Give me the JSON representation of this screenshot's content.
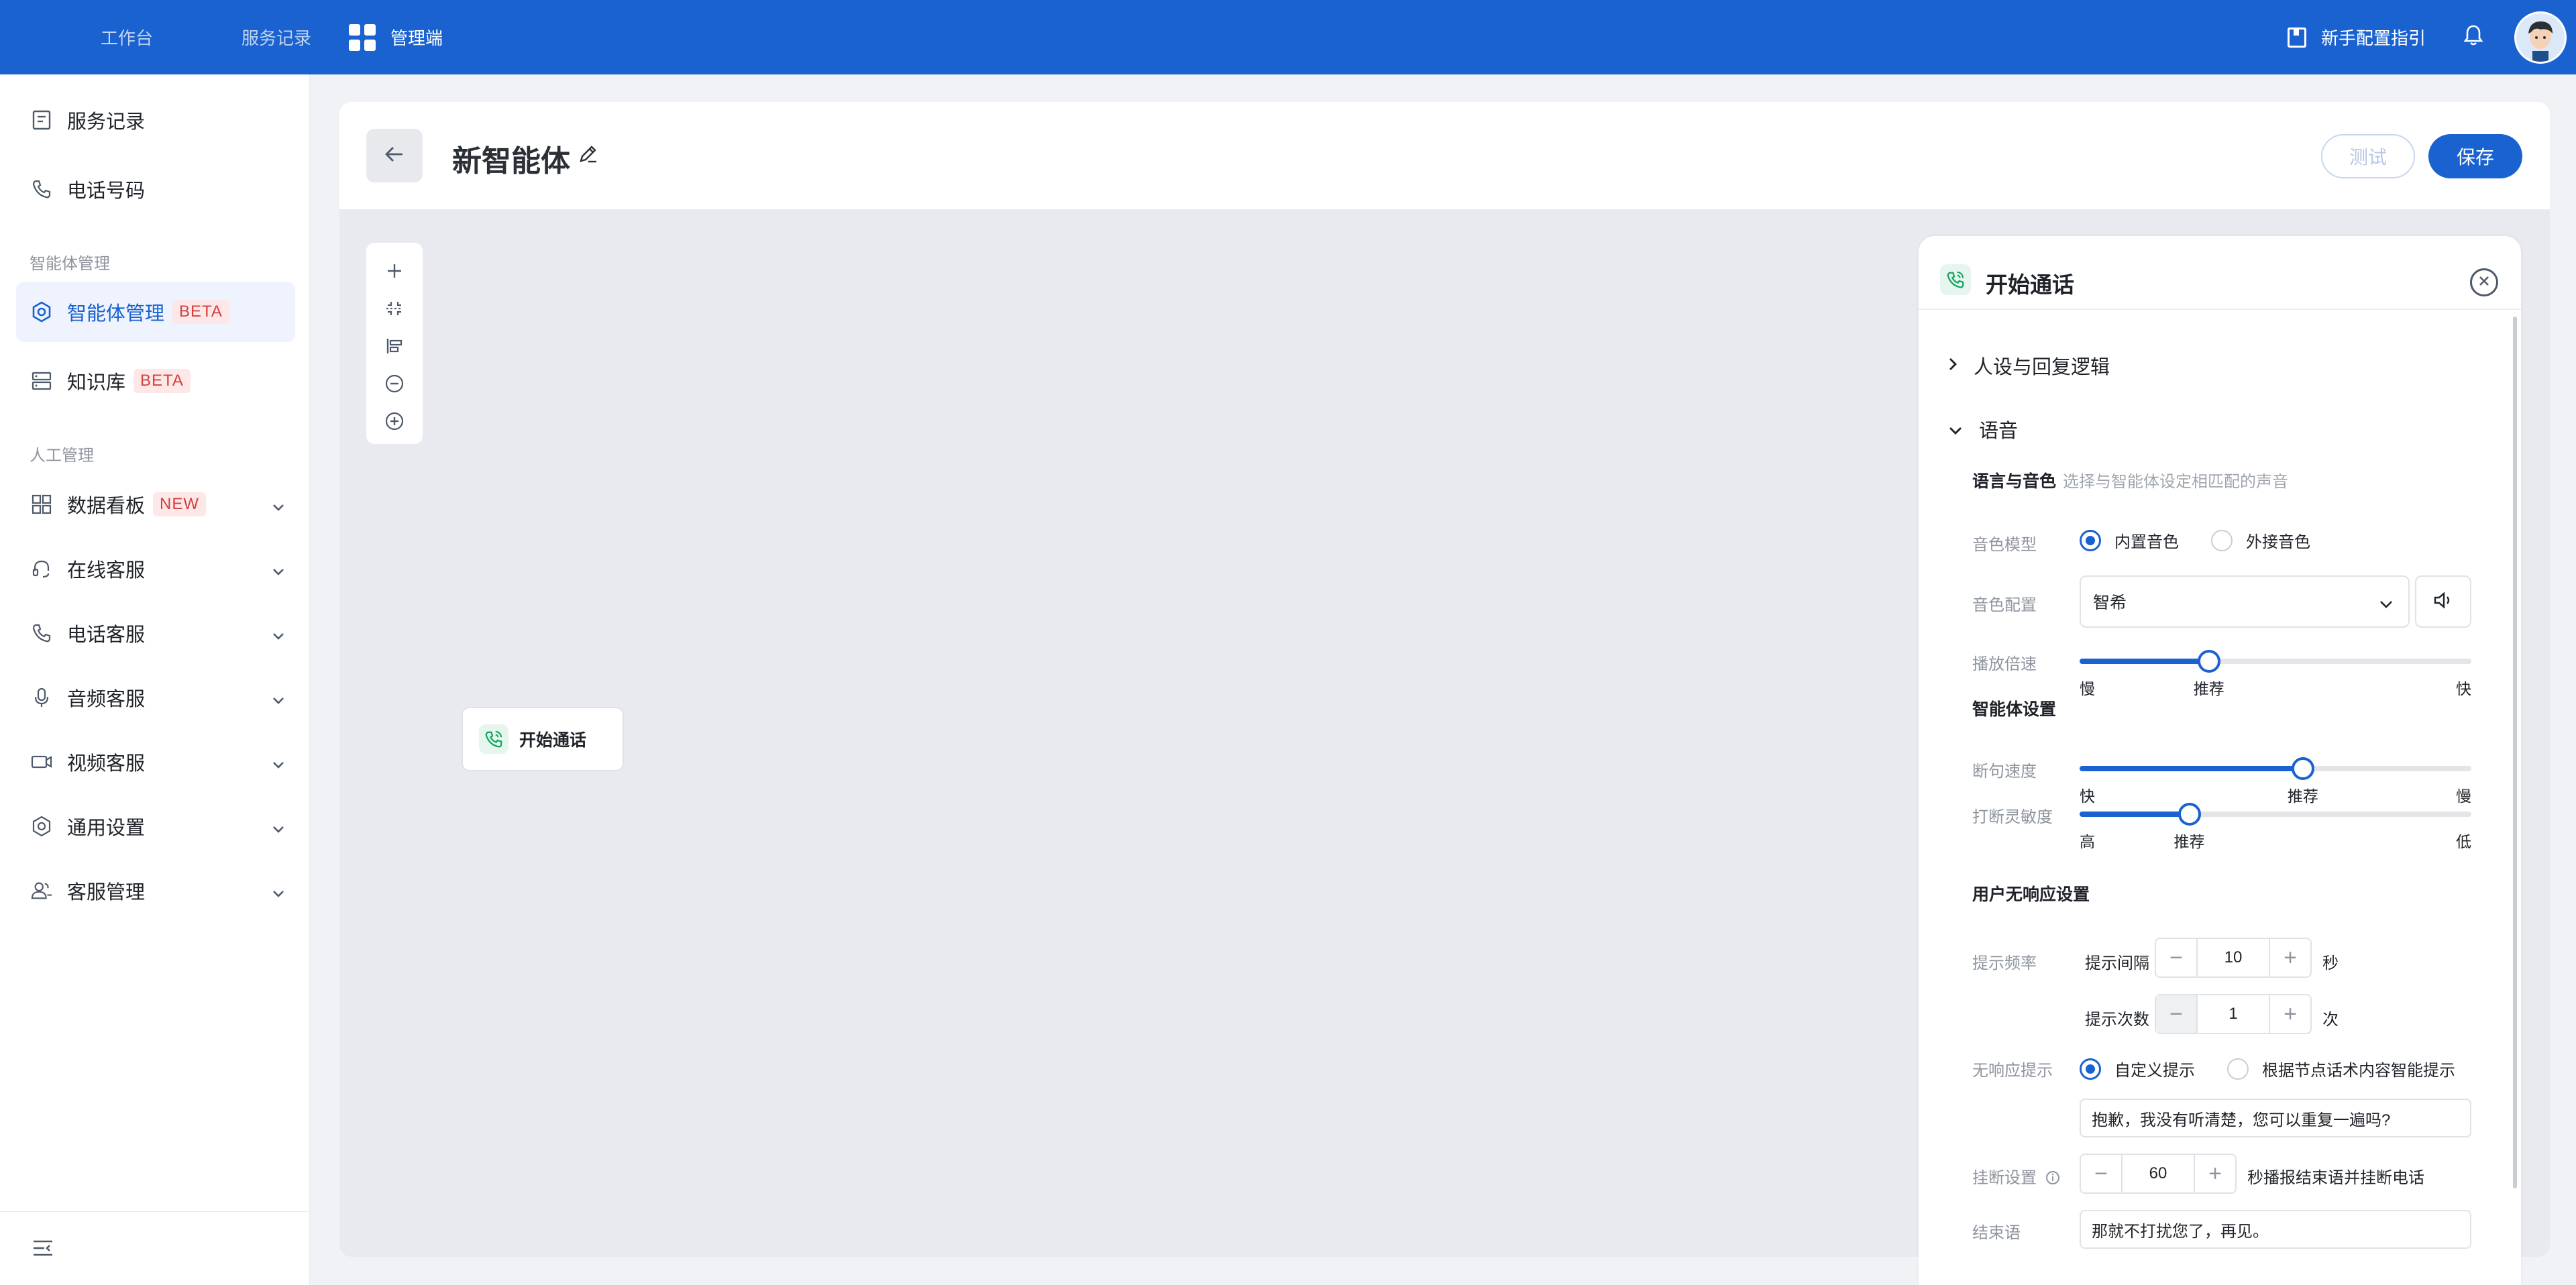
{
  "topbar": {
    "nav": [
      "工作台",
      "服务记录",
      "管理端"
    ],
    "guide": "新手配置指引"
  },
  "sidebar": {
    "items_top": [
      {
        "label": "服务记录"
      },
      {
        "label": "电话号码"
      }
    ],
    "section_ai": "智能体管理",
    "ai_items": [
      {
        "label": "智能体管理",
        "badge": "BETA"
      },
      {
        "label": "知识库",
        "badge": "BETA"
      }
    ],
    "section_human": "人工管理",
    "human_items": [
      {
        "label": "数据看板",
        "badge": "NEW"
      },
      {
        "label": "在线客服"
      },
      {
        "label": "电话客服"
      },
      {
        "label": "音频客服"
      },
      {
        "label": "视频客服"
      },
      {
        "label": "通用设置"
      },
      {
        "label": "客服管理"
      }
    ]
  },
  "header": {
    "title": "新智能体",
    "test_label": "测试",
    "save_label": "保存"
  },
  "canvas": {
    "node_label": "开始通话"
  },
  "panel": {
    "title": "开始通话",
    "section1": "人设与回复逻辑",
    "section2": "语音",
    "voice": {
      "heading": "语言与音色",
      "hint": "选择与智能体设定相匹配的声音",
      "model_label": "音色模型",
      "model_options": [
        "内置音色",
        "外接音色"
      ],
      "config_label": "音色配置",
      "config_value": "智希",
      "speed_label": "播放倍速",
      "speed_marks": [
        "慢",
        "推荐",
        "快"
      ],
      "speed_value": 0.33
    },
    "agent": {
      "heading": "智能体设置",
      "pause_label": "断句速度",
      "pause_marks": [
        "快",
        "推荐",
        "慢"
      ],
      "pause_value": 0.57,
      "interrupt_label": "打断灵敏度",
      "interrupt_marks": [
        "高",
        "推荐",
        "低"
      ],
      "interrupt_value": 0.28
    },
    "noresp": {
      "heading": "用户无响应设置",
      "freq_label": "提示频率",
      "interval_label": "提示间隔",
      "interval_value": "10",
      "interval_unit": "秒",
      "count_label": "提示次数",
      "count_value": "1",
      "count_unit": "次",
      "prompt_label": "无响应提示",
      "prompt_options": [
        "自定义提示",
        "根据节点话术内容智能提示"
      ],
      "prompt_text": "抱歉，我没有听清楚，您可以重复一遍吗?",
      "hangup_label": "挂断设置",
      "hangup_value": "60",
      "hangup_suffix": "秒播报结束语并挂断电话",
      "end_label": "结束语",
      "end_text": "那就不打扰您了，再见。"
    }
  },
  "colors": {
    "brand": "#1a62d0",
    "badge_bg": "#fde7e7",
    "badge_text": "#d53f3f",
    "phone_green": "#12a35b"
  }
}
